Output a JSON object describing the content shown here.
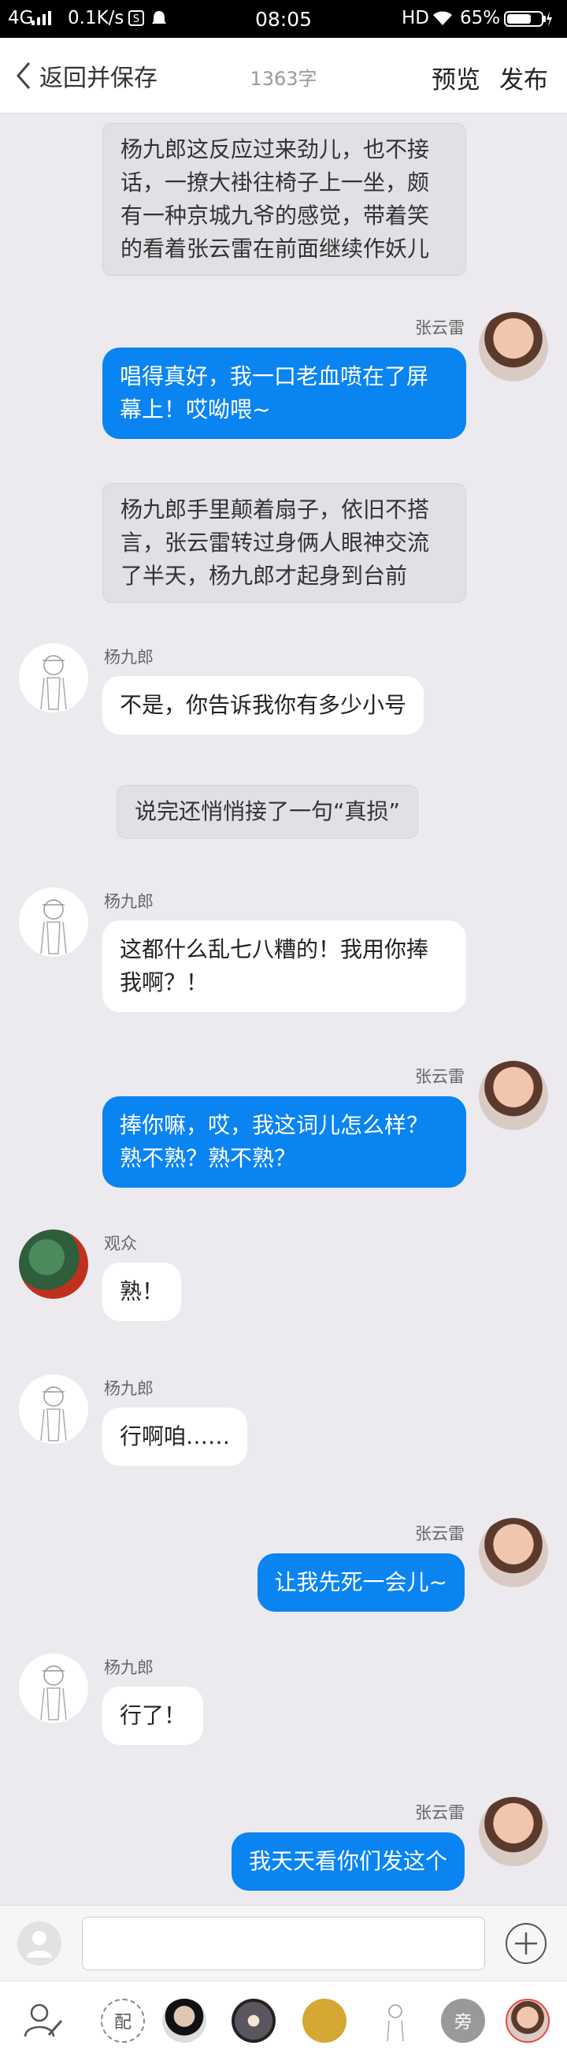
{
  "status_bar": {
    "network": "4G",
    "speed": "0.1K/s",
    "time": "08:05",
    "hd": "HD",
    "battery": "65%"
  },
  "nav": {
    "back_label": "返回并保存",
    "char_count": "1363字",
    "preview": "预览",
    "publish": "发布"
  },
  "colors": {
    "outgoing_bubble": "#0a84f0",
    "background": "#edeaef"
  },
  "messages": [
    {
      "type": "narration",
      "text": "杨九郎这反应过来劲儿，也不接话，一撩大褂往椅子上一坐，颇有一种京城九爷的感觉，带着笑的看着张云雷在前面继续作妖儿"
    },
    {
      "type": "outgoing",
      "speaker": "张云雷",
      "text": "唱得真好，我一口老血喷在了屏幕上！哎呦喂~"
    },
    {
      "type": "narration",
      "text": "杨九郎手里颠着扇子，依旧不搭言，张云雷转过身俩人眼神交流了半天，杨九郎才起身到台前"
    },
    {
      "type": "incoming",
      "speaker": "杨九郎",
      "text": "不是，你告诉我你有多少小号"
    },
    {
      "type": "narration",
      "text": "说完还悄悄接了一句“真损”"
    },
    {
      "type": "incoming",
      "speaker": "杨九郎",
      "text": "这都什么乱七八糟的！我用你捧我啊？！"
    },
    {
      "type": "outgoing",
      "speaker": "张云雷",
      "text": "捧你嘛，哎，我这词儿怎么样？熟不熟？熟不熟？"
    },
    {
      "type": "incoming",
      "speaker": "观众",
      "text": "熟！"
    },
    {
      "type": "incoming",
      "speaker": "杨九郎",
      "text": "行啊咱……"
    },
    {
      "type": "outgoing",
      "speaker": "张云雷",
      "text": "让我先死一会儿~"
    },
    {
      "type": "incoming",
      "speaker": "杨九郎",
      "text": "行了！"
    },
    {
      "type": "outgoing",
      "speaker": "张云雷",
      "text": "我天天看你们发这个"
    }
  ],
  "cast_bar": {
    "side_label": "旁",
    "add_label": "配"
  }
}
